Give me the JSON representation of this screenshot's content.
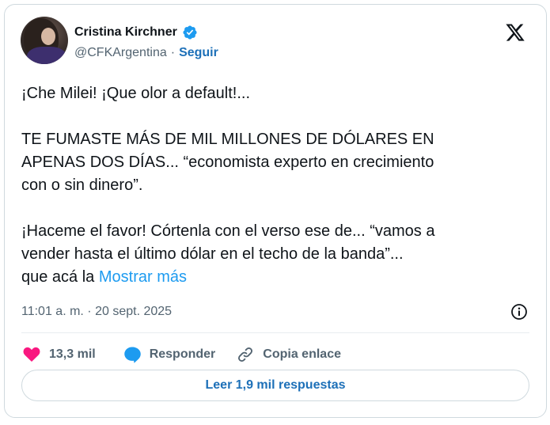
{
  "author": {
    "name": "Cristina Kirchner",
    "handle": "@CFKArgentina",
    "separator": "·",
    "follow_label": "Seguir",
    "avatar_icon": "avatar-photo",
    "verified_icon": "verified-badge-icon"
  },
  "brand": {
    "logo_icon": "x-logo-icon"
  },
  "tweet": {
    "line1": "¡Che Milei! ¡Que olor a default!...",
    "paragraph2": "TE FUMASTE MÁS DE MIL MILLONES DE DÓLARES EN\nAPENAS DOS DÍAS... “economista experto en crecimiento\ncon o sin dinero”.",
    "paragraph3": "¡Haceme el favor! Córtenla con el verso ese de... “vamos a\nvender hasta el último dólar en el techo de la banda”...\nque acá la ",
    "show_more_label": "Mostrar más"
  },
  "meta": {
    "timestamp": "11:01 a. m. · 20 sept. 2025",
    "info_icon": "info-icon"
  },
  "actions": {
    "like_count": "13,3 mil",
    "reply_label": "Responder",
    "copy_link_label": "Copia enlace"
  },
  "footer": {
    "read_replies_label": "Leer 1,9 mil respuestas"
  },
  "colors": {
    "like": "#f91880",
    "reply": "#1d9bf0",
    "link": "#1d9bf0",
    "verified": "#1d9bf0",
    "muted": "#536471",
    "text": "#0f1419",
    "border": "#cfd9de"
  }
}
